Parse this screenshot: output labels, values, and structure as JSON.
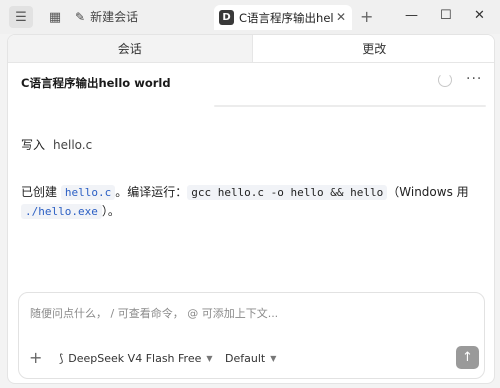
{
  "titlebar": {
    "new_chat_label": "新建会话",
    "tab": {
      "badge": "D",
      "title": "C语言程序输出hello world"
    }
  },
  "segments": {
    "conversation": "会话",
    "changes": "更改"
  },
  "conversation": {
    "title": "C语言程序输出hello world",
    "message1": {
      "prefix": "写入",
      "filename": "hello.c"
    },
    "message2": {
      "p1": "已创建 ",
      "code1": "hello.c",
      "p2": "。编译运行：",
      "code2": "gcc hello.c -o hello && hello",
      "p3": "（Windows 用 ",
      "code3": "./hello.exe",
      "p4": "）。"
    }
  },
  "composer": {
    "placeholder": "随便问点什么， / 可查看命令， @ 可添加上下文...",
    "model": "DeepSeek V4 Flash Free",
    "mode": "Default"
  },
  "icons": [
    "menu-icon",
    "grid-icon",
    "edit-icon",
    "close-icon",
    "plus-icon",
    "minimize-icon",
    "maximize-icon",
    "spinner-icon",
    "more-icon",
    "model-icon",
    "chevron-down-icon",
    "send-arrow-icon"
  ]
}
